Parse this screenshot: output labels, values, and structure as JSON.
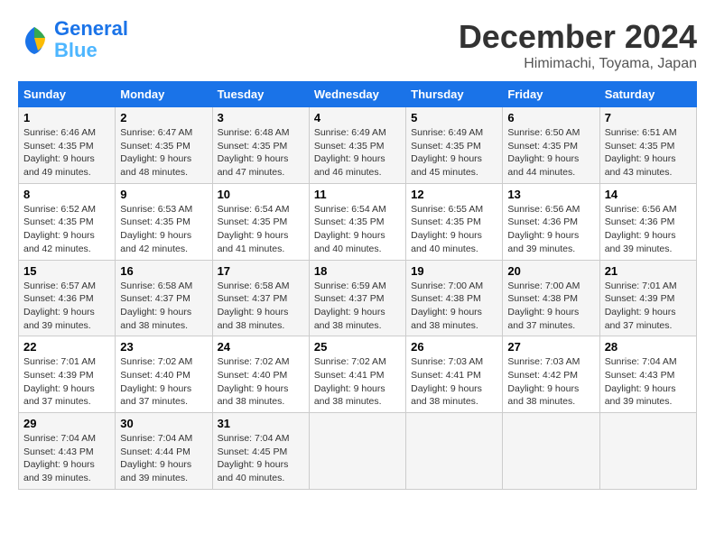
{
  "header": {
    "logo_line1": "General",
    "logo_line2": "Blue",
    "month_title": "December 2024",
    "location": "Himimachi, Toyama, Japan"
  },
  "days_of_week": [
    "Sunday",
    "Monday",
    "Tuesday",
    "Wednesday",
    "Thursday",
    "Friday",
    "Saturday"
  ],
  "weeks": [
    [
      {
        "day": 1,
        "sunrise": "6:46 AM",
        "sunset": "4:35 PM",
        "daylight": "9 hours and 49 minutes."
      },
      {
        "day": 2,
        "sunrise": "6:47 AM",
        "sunset": "4:35 PM",
        "daylight": "9 hours and 48 minutes."
      },
      {
        "day": 3,
        "sunrise": "6:48 AM",
        "sunset": "4:35 PM",
        "daylight": "9 hours and 47 minutes."
      },
      {
        "day": 4,
        "sunrise": "6:49 AM",
        "sunset": "4:35 PM",
        "daylight": "9 hours and 46 minutes."
      },
      {
        "day": 5,
        "sunrise": "6:49 AM",
        "sunset": "4:35 PM",
        "daylight": "9 hours and 45 minutes."
      },
      {
        "day": 6,
        "sunrise": "6:50 AM",
        "sunset": "4:35 PM",
        "daylight": "9 hours and 44 minutes."
      },
      {
        "day": 7,
        "sunrise": "6:51 AM",
        "sunset": "4:35 PM",
        "daylight": "9 hours and 43 minutes."
      }
    ],
    [
      {
        "day": 8,
        "sunrise": "6:52 AM",
        "sunset": "4:35 PM",
        "daylight": "9 hours and 42 minutes."
      },
      {
        "day": 9,
        "sunrise": "6:53 AM",
        "sunset": "4:35 PM",
        "daylight": "9 hours and 42 minutes."
      },
      {
        "day": 10,
        "sunrise": "6:54 AM",
        "sunset": "4:35 PM",
        "daylight": "9 hours and 41 minutes."
      },
      {
        "day": 11,
        "sunrise": "6:54 AM",
        "sunset": "4:35 PM",
        "daylight": "9 hours and 40 minutes."
      },
      {
        "day": 12,
        "sunrise": "6:55 AM",
        "sunset": "4:35 PM",
        "daylight": "9 hours and 40 minutes."
      },
      {
        "day": 13,
        "sunrise": "6:56 AM",
        "sunset": "4:36 PM",
        "daylight": "9 hours and 39 minutes."
      },
      {
        "day": 14,
        "sunrise": "6:56 AM",
        "sunset": "4:36 PM",
        "daylight": "9 hours and 39 minutes."
      }
    ],
    [
      {
        "day": 15,
        "sunrise": "6:57 AM",
        "sunset": "4:36 PM",
        "daylight": "9 hours and 39 minutes."
      },
      {
        "day": 16,
        "sunrise": "6:58 AM",
        "sunset": "4:37 PM",
        "daylight": "9 hours and 38 minutes."
      },
      {
        "day": 17,
        "sunrise": "6:58 AM",
        "sunset": "4:37 PM",
        "daylight": "9 hours and 38 minutes."
      },
      {
        "day": 18,
        "sunrise": "6:59 AM",
        "sunset": "4:37 PM",
        "daylight": "9 hours and 38 minutes."
      },
      {
        "day": 19,
        "sunrise": "7:00 AM",
        "sunset": "4:38 PM",
        "daylight": "9 hours and 38 minutes."
      },
      {
        "day": 20,
        "sunrise": "7:00 AM",
        "sunset": "4:38 PM",
        "daylight": "9 hours and 37 minutes."
      },
      {
        "day": 21,
        "sunrise": "7:01 AM",
        "sunset": "4:39 PM",
        "daylight": "9 hours and 37 minutes."
      }
    ],
    [
      {
        "day": 22,
        "sunrise": "7:01 AM",
        "sunset": "4:39 PM",
        "daylight": "9 hours and 37 minutes."
      },
      {
        "day": 23,
        "sunrise": "7:02 AM",
        "sunset": "4:40 PM",
        "daylight": "9 hours and 37 minutes."
      },
      {
        "day": 24,
        "sunrise": "7:02 AM",
        "sunset": "4:40 PM",
        "daylight": "9 hours and 38 minutes."
      },
      {
        "day": 25,
        "sunrise": "7:02 AM",
        "sunset": "4:41 PM",
        "daylight": "9 hours and 38 minutes."
      },
      {
        "day": 26,
        "sunrise": "7:03 AM",
        "sunset": "4:41 PM",
        "daylight": "9 hours and 38 minutes."
      },
      {
        "day": 27,
        "sunrise": "7:03 AM",
        "sunset": "4:42 PM",
        "daylight": "9 hours and 38 minutes."
      },
      {
        "day": 28,
        "sunrise": "7:04 AM",
        "sunset": "4:43 PM",
        "daylight": "9 hours and 39 minutes."
      }
    ],
    [
      {
        "day": 29,
        "sunrise": "7:04 AM",
        "sunset": "4:43 PM",
        "daylight": "9 hours and 39 minutes."
      },
      {
        "day": 30,
        "sunrise": "7:04 AM",
        "sunset": "4:44 PM",
        "daylight": "9 hours and 39 minutes."
      },
      {
        "day": 31,
        "sunrise": "7:04 AM",
        "sunset": "4:45 PM",
        "daylight": "9 hours and 40 minutes."
      },
      null,
      null,
      null,
      null
    ]
  ]
}
